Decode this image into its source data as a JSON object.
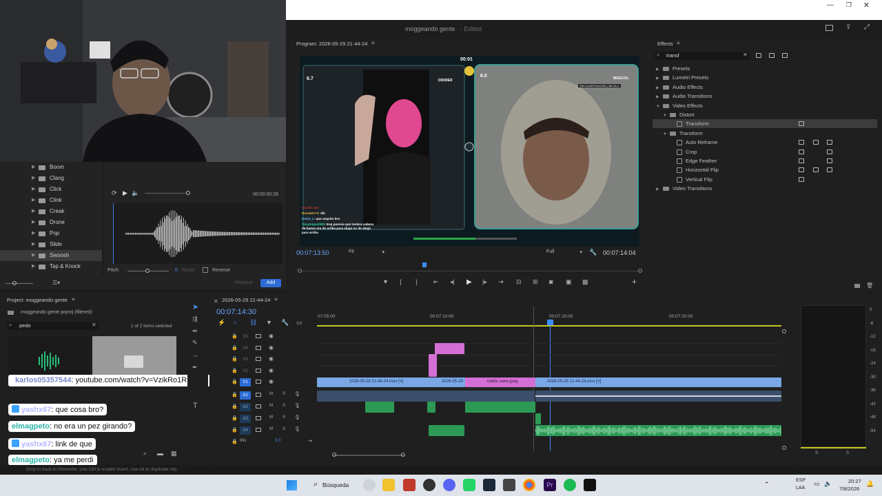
{
  "window": {
    "title": "moggeando gente",
    "status": "- Edited"
  },
  "audio_browser": {
    "folders": [
      "Boom",
      "Clang",
      "Click",
      "Clink",
      "Creak",
      "Drone",
      "Pop",
      "Slide",
      "Swoosh",
      "Tap & Knock"
    ],
    "selected": "Swoosh",
    "time": "00:00:00:26",
    "pitch_label": "Pitch:",
    "pitch_value": "0",
    "reset_label": "Reset",
    "reverse_label": "Reverse",
    "replace_label": "Replace",
    "add_label": "Add"
  },
  "program": {
    "title": "Program: 2026-05-29 21-44-24",
    "timecode_left": "00:07:13:50",
    "fit": "Fit",
    "quality": "Full",
    "timecode_right": "00:07:14:04",
    "video_timer": "00:01",
    "left_score": "6.7",
    "right_score": "6.0",
    "left_name": "DIDDIER",
    "right_name": "MOGCOL",
    "right_rank": "SIN CLASIFICACIÓN | 381 ELO",
    "chat_lines": [
      {
        "user": "escribi mal",
        "msg": ""
      },
      {
        "user": "Nana69173",
        "msg": ": riki"
      },
      {
        "user": "Kevin_L",
        "msg": ": que asquito bro"
      },
      {
        "user": "Tonymiguel890",
        "msg": ": Esq parecia que tuviera cabeza de huevo era de arriba para abajo no de abajo para arriba"
      }
    ]
  },
  "effects": {
    "title": "Effects",
    "search": "transf",
    "items": [
      {
        "label": "Presets",
        "level": 0,
        "expanded": false
      },
      {
        "label": "Lumetri Presets",
        "level": 0,
        "expanded": false
      },
      {
        "label": "Audio Effects",
        "level": 0,
        "expanded": false
      },
      {
        "label": "Audio Transitions",
        "level": 0,
        "expanded": false
      },
      {
        "label": "Video Effects",
        "level": 0,
        "expanded": true
      },
      {
        "label": "Distort",
        "level": 1,
        "expanded": true
      },
      {
        "label": "Transform",
        "level": 2,
        "effect": true,
        "selected": true
      },
      {
        "label": "Transform",
        "level": 1,
        "expanded": true
      },
      {
        "label": "Auto Reframe",
        "level": 2,
        "effect": true
      },
      {
        "label": "Crop",
        "level": 2,
        "effect": true
      },
      {
        "label": "Edge Feather",
        "level": 2,
        "effect": true
      },
      {
        "label": "Horizontal Flip",
        "level": 2,
        "effect": true
      },
      {
        "label": "Vertical Flip",
        "level": 2,
        "effect": true
      },
      {
        "label": "Video Transitions",
        "level": 0,
        "expanded": false
      }
    ]
  },
  "project": {
    "title": "Project: moggeando gente",
    "file": "moggeando gente.prproj (filtered)",
    "search": "pedo",
    "count": "1 of 2 items selected"
  },
  "timeline": {
    "tab": "2026-05-29 21-44-24",
    "timecode": "00:07:14:30",
    "ruler": [
      "07:05:00",
      "00:07:10:00",
      "00:07:15:00",
      "00:07:20:00"
    ],
    "video_tracks": [
      "V5",
      "V4",
      "V3",
      "V2",
      "V1"
    ],
    "audio_tracks": [
      "A1",
      "A2",
      "A3",
      "A4"
    ],
    "mix_label": "Mix",
    "mix_value": "0.0",
    "clip_v1a": "2026-05-29 21-44-24.mov [V]",
    "clip_v1b": "2026-05-29",
    "clip_v1c": "loddix calvo.jpeg",
    "clip_v1d": "2026-05-29 21-44-24.mov [V]"
  },
  "meter": {
    "labels": [
      "0",
      "-6",
      "-12",
      "-18",
      "-24",
      "-30",
      "-36",
      "-42",
      "-48",
      "-54"
    ],
    "solo": [
      "S",
      "S"
    ]
  },
  "stream_chat": [
    {
      "user": "karlos05357544",
      "msg": ": youtube.com/watch?v=VzikRo1RGVE",
      "color": "#7b88c9"
    },
    {
      "user": "yashx67",
      "msg": ": que cosa bro?",
      "color": "#b6b6ff"
    },
    {
      "user": "elmagpeto",
      "msg": ": no era un pez girando?",
      "color": "#2fb4a8"
    },
    {
      "user": "yashx67",
      "msg": ": link de que",
      "color": "#b6b6ff"
    },
    {
      "user": "elmagpeto",
      "msg": ": ya me perdi",
      "color": "#2fb4a8"
    }
  ],
  "statusbar": {
    "hint": "Drop in track to Overwrite. Use Ctrl to enable Insert. Use Alt to duplicate clip."
  },
  "taskbar": {
    "search": "Búsqueda",
    "lang1": "ESP",
    "lang2": "LAA",
    "time": "20:27",
    "date": "7/8/2026"
  }
}
